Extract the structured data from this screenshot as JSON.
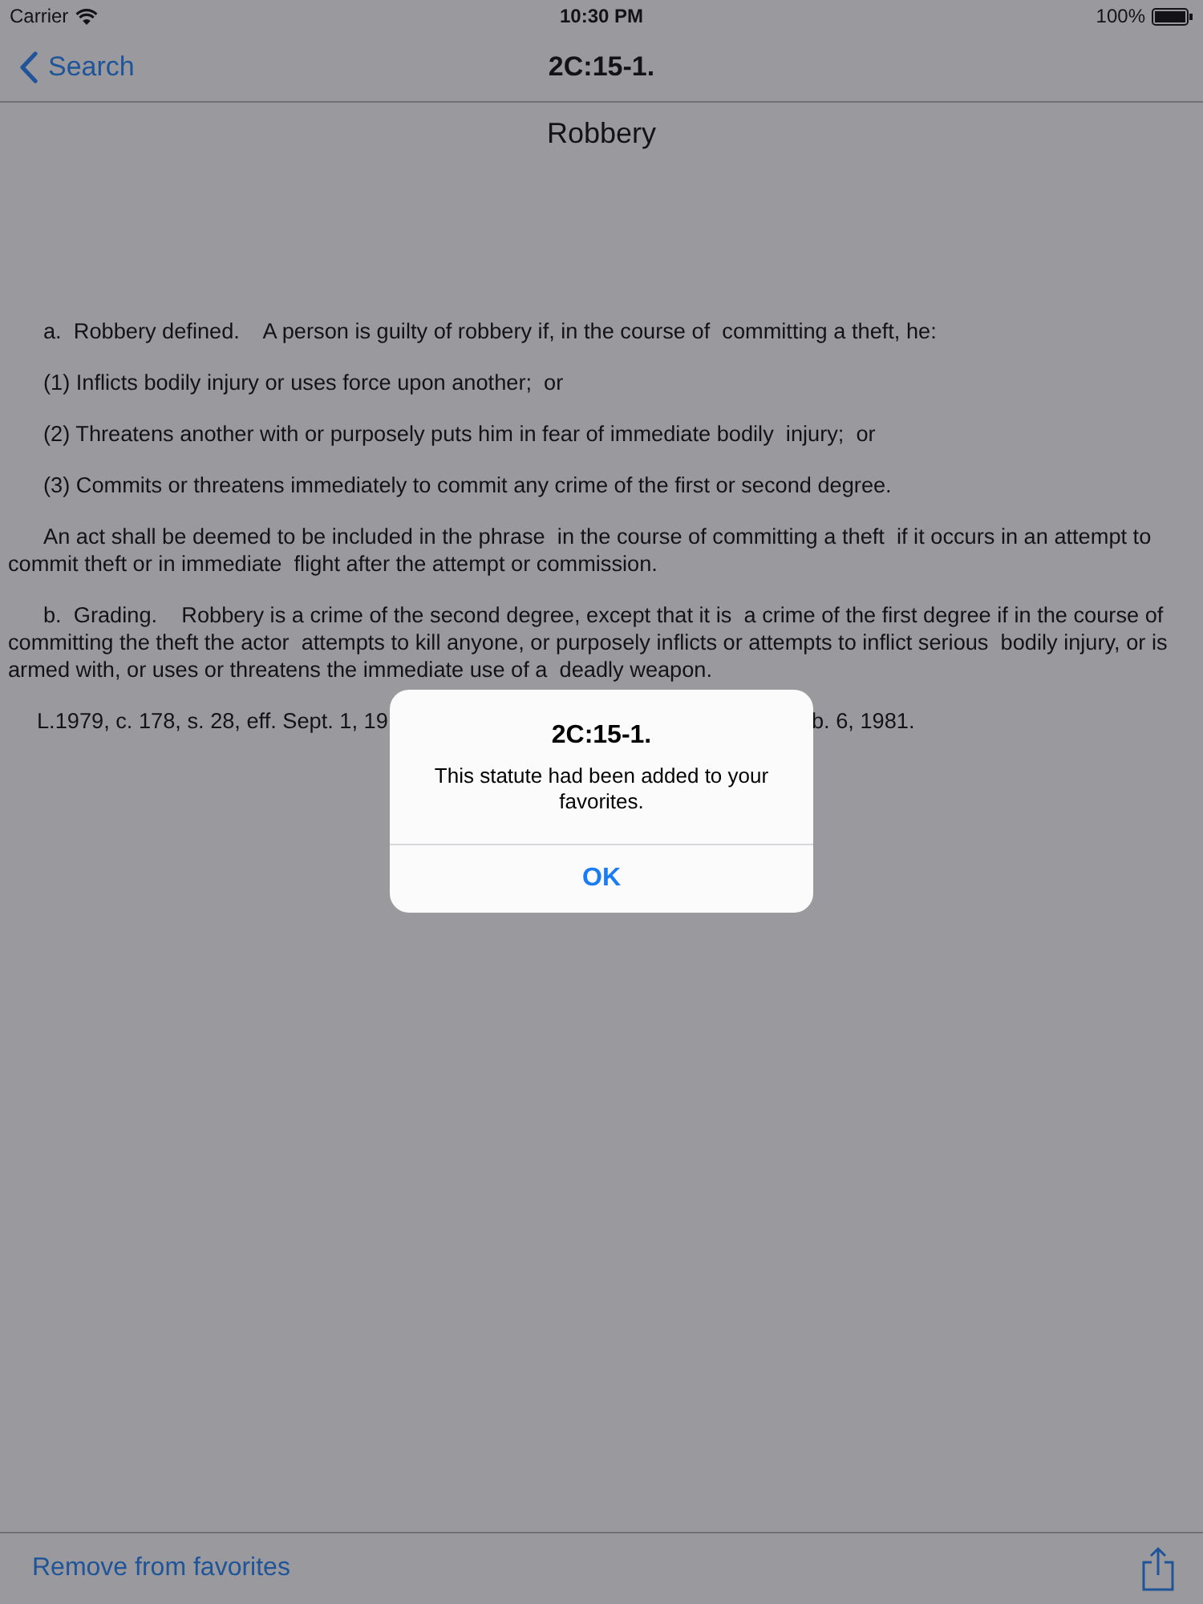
{
  "status_bar": {
    "carrier": "Carrier",
    "time": "10:30 PM",
    "battery": "100%"
  },
  "nav_bar": {
    "back": "Search",
    "title": "2C:15-1."
  },
  "statute": {
    "heading": "Robbery",
    "paragraphs": [
      "a.  Robbery defined.    A person is guilty of robbery if, in the course of  committing a theft, he:",
      "(1) Inflicts bodily injury or uses force upon another;  or",
      "(2) Threatens another with or purposely puts him in fear of immediate bodily  injury;  or",
      "(3) Commits or threatens immediately to commit any crime of the first or second degree.",
      "An act shall be deemed to be included in the phrase  in the course of committing a theft  if it occurs in an attempt to commit theft or in immediate  flight after the attempt or commission.",
      "b.  Grading.    Robbery is a crime of the second degree, except that it is  a crime of the first degree if in the course of committing the theft the actor  attempts to kill anyone, or purposely inflicts or attempts to inflict serious  bodily injury, or is armed with, or uses or threatens the immediate use of a  deadly weapon."
    ],
    "citation_left": "L.1979, c. 178, s. 28, eff. Sept. 1, 19",
    "citation_right": "b. 6, 1981."
  },
  "alert": {
    "title": "2C:15-1.",
    "message": "This statute had been added to your favorites.",
    "button": "OK"
  },
  "toolbar": {
    "action": "Remove from favorites"
  }
}
